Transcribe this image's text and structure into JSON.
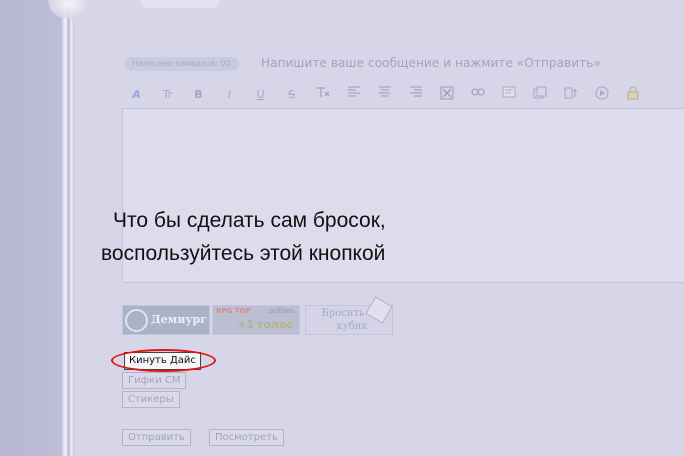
{
  "form": {
    "char_counter": "Написано символов: 00",
    "instruction": "Напишите ваше сообщение и нажмите «Отправить»"
  },
  "toolbar": {
    "font_label": "Tr",
    "bold_label": "B",
    "italic_label": "I",
    "underline_label": "U",
    "strike_label": "S",
    "icons": [
      "font-color-icon",
      "font-size-icon",
      "bold-icon",
      "italic-icon",
      "underline-icon",
      "strikethrough-icon",
      "clear-format-icon",
      "align-left-icon",
      "align-center-icon",
      "align-right-icon",
      "hide-icon",
      "link-icon",
      "spoiler-icon",
      "quote-icon",
      "code-icon",
      "play-icon",
      "lock-icon"
    ]
  },
  "overlay": {
    "line1": "Что бы сделать сам бросок,",
    "line2": "воспользуйтесь этой кнопкой"
  },
  "banners": {
    "demiurg": "Демиург",
    "rpg_top": "RPG TOP",
    "rpg_add": "добавь",
    "rpg_votes": "+1 голос",
    "dice_line1": "Бросить",
    "dice_line2": "кубик"
  },
  "buttons": {
    "roll_dice": "Кинуть Дайс",
    "gifs": "Гифки СМ",
    "stickers": "Стикеры",
    "submit": "Отправить",
    "preview": "Посмотреть"
  },
  "colors": {
    "page_bg": "#d6d6e8",
    "highlight_ring": "#e01414",
    "overlay_text": "#111111"
  }
}
